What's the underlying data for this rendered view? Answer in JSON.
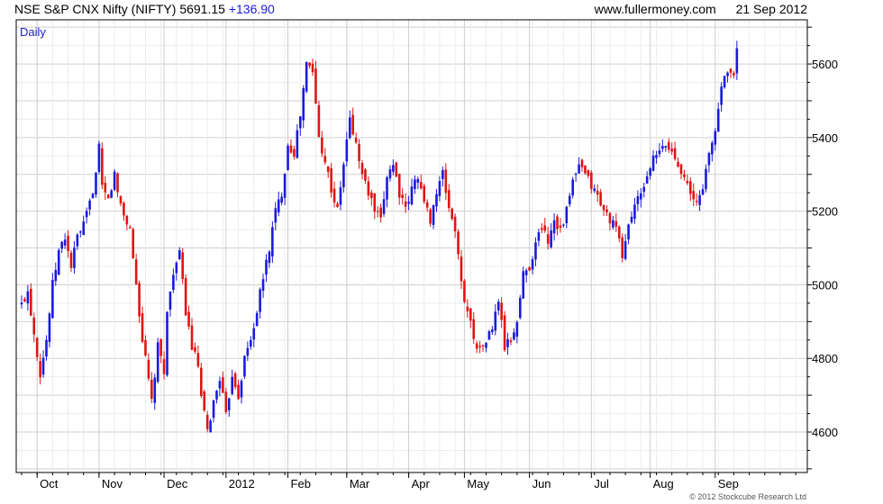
{
  "header": {
    "name": "NSE S&P CNX Nifty (NIFTY)",
    "price": "5691.15",
    "change": "+136.90",
    "source": "www.fullermoney.com",
    "date": "21 Sep 2012"
  },
  "period_label": "Daily",
  "copyright": "© 2012 Stockcube Research Ltd",
  "colors": {
    "up": "#1a1adb",
    "down": "#e01414",
    "grid": "#d9d9d9",
    "axis": "#000000"
  },
  "chart_data": {
    "type": "candlestick",
    "y_axis_side": "right",
    "ylim": [
      4490,
      5720
    ],
    "yticks": [
      4600,
      4800,
      5000,
      5200,
      5400,
      5600
    ],
    "xlim": [
      0,
      252
    ],
    "xticks": [
      {
        "label": "Oct",
        "x": 5
      },
      {
        "label": "Nov",
        "x": 25
      },
      {
        "label": "Dec",
        "x": 46
      },
      {
        "label": "2012",
        "x": 66
      },
      {
        "label": "Feb",
        "x": 86
      },
      {
        "label": "Mar",
        "x": 105
      },
      {
        "label": "Apr",
        "x": 125
      },
      {
        "label": "May",
        "x": 143
      },
      {
        "label": "Jun",
        "x": 164
      },
      {
        "label": "Jul",
        "x": 184
      },
      {
        "label": "Aug",
        "x": 203
      },
      {
        "label": "Sep",
        "x": 224
      }
    ],
    "grid": true,
    "anchors": [
      [
        0,
        4945
      ],
      [
        2,
        4985
      ],
      [
        4,
        4870
      ],
      [
        6,
        4760
      ],
      [
        8,
        4850
      ],
      [
        10,
        5000
      ],
      [
        12,
        5090
      ],
      [
        14,
        5130
      ],
      [
        16,
        5050
      ],
      [
        18,
        5130
      ],
      [
        20,
        5160
      ],
      [
        22,
        5220
      ],
      [
        24,
        5300
      ],
      [
        25,
        5370
      ],
      [
        26,
        5260
      ],
      [
        28,
        5230
      ],
      [
        30,
        5300
      ],
      [
        31,
        5250
      ],
      [
        33,
        5190
      ],
      [
        35,
        5150
      ],
      [
        37,
        5000
      ],
      [
        39,
        4850
      ],
      [
        41,
        4740
      ],
      [
        42,
        4680
      ],
      [
        44,
        4830
      ],
      [
        46,
        4770
      ],
      [
        47,
        4920
      ],
      [
        49,
        5040
      ],
      [
        51,
        5080
      ],
      [
        53,
        4930
      ],
      [
        55,
        4830
      ],
      [
        57,
        4780
      ],
      [
        58,
        4690
      ],
      [
        60,
        4600
      ],
      [
        62,
        4680
      ],
      [
        64,
        4750
      ],
      [
        66,
        4640
      ],
      [
        68,
        4760
      ],
      [
        70,
        4700
      ],
      [
        72,
        4800
      ],
      [
        74,
        4850
      ],
      [
        76,
        4930
      ],
      [
        78,
        5020
      ],
      [
        80,
        5100
      ],
      [
        82,
        5200
      ],
      [
        84,
        5250
      ],
      [
        86,
        5380
      ],
      [
        88,
        5360
      ],
      [
        90,
        5460
      ],
      [
        92,
        5600
      ],
      [
        94,
        5580
      ],
      [
        96,
        5400
      ],
      [
        98,
        5340
      ],
      [
        100,
        5260
      ],
      [
        102,
        5200
      ],
      [
        104,
        5330
      ],
      [
        106,
        5450
      ],
      [
        108,
        5380
      ],
      [
        110,
        5300
      ],
      [
        112,
        5250
      ],
      [
        114,
        5200
      ],
      [
        116,
        5170
      ],
      [
        118,
        5300
      ],
      [
        120,
        5330
      ],
      [
        122,
        5250
      ],
      [
        124,
        5200
      ],
      [
        126,
        5260
      ],
      [
        128,
        5300
      ],
      [
        130,
        5220
      ],
      [
        132,
        5180
      ],
      [
        134,
        5250
      ],
      [
        136,
        5300
      ],
      [
        138,
        5210
      ],
      [
        140,
        5150
      ],
      [
        142,
        5000
      ],
      [
        144,
        4930
      ],
      [
        146,
        4860
      ],
      [
        148,
        4820
      ],
      [
        150,
        4850
      ],
      [
        152,
        4880
      ],
      [
        154,
        4960
      ],
      [
        156,
        4830
      ],
      [
        158,
        4850
      ],
      [
        160,
        4900
      ],
      [
        162,
        5030
      ],
      [
        164,
        5050
      ],
      [
        166,
        5110
      ],
      [
        168,
        5160
      ],
      [
        170,
        5120
      ],
      [
        172,
        5180
      ],
      [
        174,
        5150
      ],
      [
        176,
        5200
      ],
      [
        178,
        5280
      ],
      [
        180,
        5320
      ],
      [
        182,
        5300
      ],
      [
        184,
        5270
      ],
      [
        186,
        5240
      ],
      [
        188,
        5200
      ],
      [
        190,
        5180
      ],
      [
        192,
        5150
      ],
      [
        194,
        5080
      ],
      [
        196,
        5160
      ],
      [
        198,
        5220
      ],
      [
        200,
        5240
      ],
      [
        202,
        5300
      ],
      [
        204,
        5340
      ],
      [
        206,
        5360
      ],
      [
        208,
        5380
      ],
      [
        210,
        5360
      ],
      [
        212,
        5330
      ],
      [
        214,
        5300
      ],
      [
        216,
        5240
      ],
      [
        218,
        5220
      ],
      [
        220,
        5270
      ],
      [
        222,
        5350
      ],
      [
        224,
        5420
      ],
      [
        226,
        5540
      ],
      [
        228,
        5590
      ],
      [
        230,
        5560
      ],
      [
        231,
        5650
      ]
    ]
  }
}
